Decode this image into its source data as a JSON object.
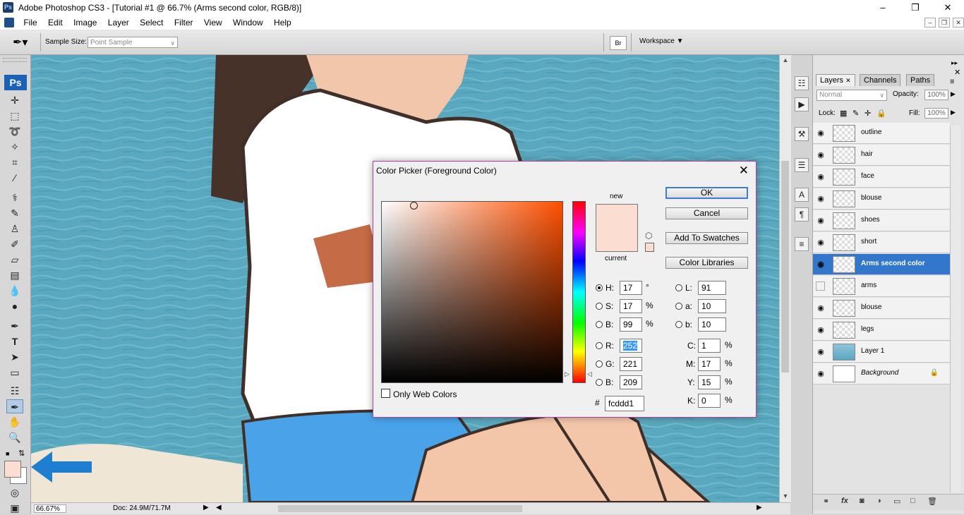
{
  "window": {
    "title": "Adobe Photoshop CS3 - [Tutorial #1 @ 66.7% (Arms second color, RGB/8)]",
    "app_badge": "Ps"
  },
  "menu": [
    "File",
    "Edit",
    "Image",
    "Layer",
    "Select",
    "Filter",
    "View",
    "Window",
    "Help"
  ],
  "options_bar": {
    "sample_size_label": "Sample Size:",
    "sample_size_value": "Point Sample",
    "workspace_label": "Workspace"
  },
  "colors": {
    "foreground": "#fcddd1",
    "selection": "#3377cc",
    "accent_arrow": "#1e7fd0"
  },
  "status_bar": {
    "zoom": "66.67%",
    "doc": "Doc: 24.9M/71.7M"
  },
  "layers_panel": {
    "tabs": [
      "Layers",
      "Channels",
      "Paths"
    ],
    "blend_mode": "Normal",
    "opacity_label": "Opacity:",
    "opacity_value": "100%",
    "lock_label": "Lock:",
    "fill_label": "Fill:",
    "fill_value": "100%",
    "layers": [
      {
        "name": "outline",
        "visible": true
      },
      {
        "name": "hair",
        "visible": true
      },
      {
        "name": "face",
        "visible": true
      },
      {
        "name": "blouse",
        "visible": true
      },
      {
        "name": "shoes",
        "visible": true
      },
      {
        "name": "short",
        "visible": true
      },
      {
        "name": "Arms second color",
        "visible": true,
        "selected": true
      },
      {
        "name": "arms",
        "visible": false
      },
      {
        "name": "blouse",
        "visible": true
      },
      {
        "name": "legs",
        "visible": true
      },
      {
        "name": "Layer 1",
        "visible": true
      },
      {
        "name": "Background",
        "visible": true,
        "locked": true
      }
    ]
  },
  "color_picker": {
    "title": "Color Picker (Foreground Color)",
    "new_label": "new",
    "current_label": "current",
    "buttons": {
      "ok": "OK",
      "cancel": "Cancel",
      "add_to_swatches": "Add To Swatches",
      "color_libraries": "Color Libraries"
    },
    "only_web_colors": "Only Web Colors",
    "hsb": {
      "h": "17",
      "s": "17",
      "b": "99"
    },
    "rgb": {
      "r": "252",
      "g": "221",
      "b": "209"
    },
    "lab": {
      "l": "91",
      "a": "10",
      "b": "10"
    },
    "cmyk": {
      "c": "1",
      "m": "17",
      "y": "15",
      "k": "0"
    },
    "hex": "fcddd1",
    "labels": {
      "h": "H:",
      "s": "S:",
      "b": "B:",
      "r": "R:",
      "g": "G:",
      "b2": "B:",
      "l": "L:",
      "a": "a:",
      "lb": "b:",
      "c": "C:",
      "m": "M:",
      "y": "Y:",
      "k": "K:",
      "hash": "#"
    },
    "units": {
      "deg": "°",
      "pct": "%"
    }
  }
}
